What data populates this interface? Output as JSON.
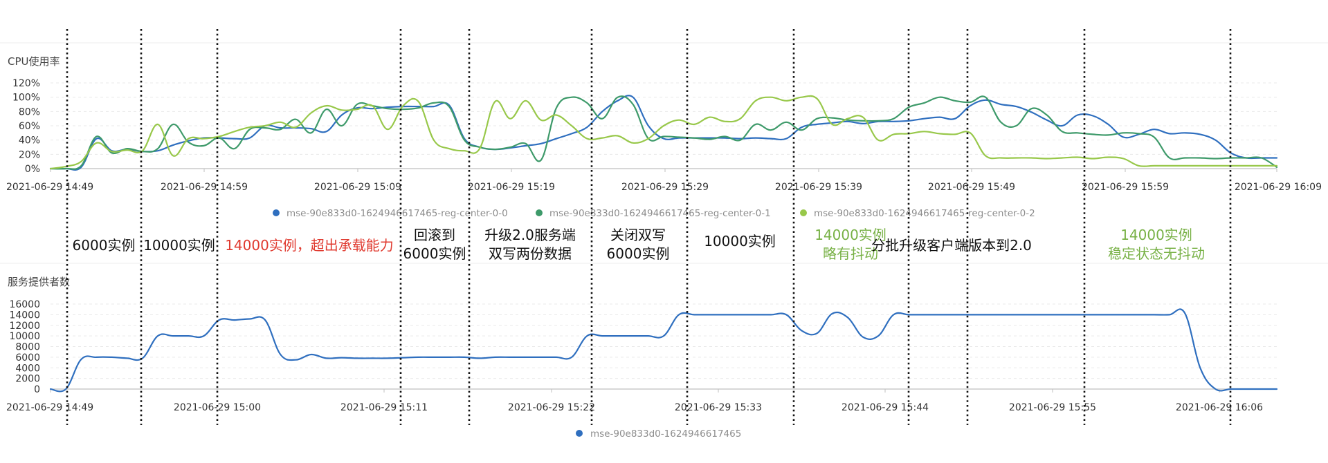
{
  "colors": {
    "series_blue": "#2f6fbf",
    "series_green": "#3e9a6a",
    "series_lightgreen": "#98c84a",
    "annotation_black": "#111111",
    "annotation_red": "#e03a2f",
    "annotation_green": "#78b146",
    "grid": "#e9e9e9",
    "axis": "#bfbfbf",
    "divider": "#111111"
  },
  "chart_data": [
    {
      "type": "line",
      "title": "CPU使用率",
      "y_ticks": [
        "120%",
        "100%",
        "80%",
        "60%",
        "40%",
        "20%",
        "0%"
      ],
      "ylim": [
        0,
        120
      ],
      "x_ticks": [
        "2021-06-29 14:49",
        "2021-06-29 14:59",
        "2021-06-29 15:09",
        "2021-06-29 15:19",
        "2021-06-29 15:29",
        "2021-06-29 15:39",
        "2021-06-29 15:49",
        "2021-06-29 15:59",
        "2021-06-29 16:09"
      ],
      "grid": true,
      "legend_position": "bottom",
      "series": [
        {
          "name": "mse-90e833d0-1624946617465-reg-center-0-0",
          "color_key": "series_blue",
          "x_minutes": [
            0,
            1,
            2,
            3,
            4,
            5,
            6,
            7,
            8,
            9,
            10,
            11,
            12,
            13,
            14,
            15,
            16,
            17,
            18,
            19,
            20,
            21,
            22,
            23,
            24,
            25,
            26,
            27,
            28,
            29,
            30,
            31,
            32,
            33,
            34,
            35,
            36,
            37,
            38,
            39,
            40,
            41,
            42,
            43,
            44,
            45,
            46,
            47,
            48,
            49,
            50,
            51,
            52,
            53,
            54,
            55,
            56,
            57,
            58,
            59,
            60,
            61,
            62,
            63,
            64,
            65,
            66,
            67,
            68,
            69,
            70,
            71,
            72,
            73,
            74,
            75,
            76,
            77,
            78,
            79,
            80
          ],
          "values": [
            0,
            0,
            2,
            42,
            25,
            27,
            24,
            25,
            33,
            39,
            43,
            43,
            42,
            43,
            60,
            57,
            57,
            56,
            52,
            75,
            85,
            84,
            86,
            87,
            87,
            87,
            89,
            42,
            30,
            27,
            29,
            32,
            35,
            42,
            49,
            58,
            80,
            95,
            100,
            60,
            42,
            43,
            43,
            43,
            43,
            42,
            43,
            42,
            42,
            58,
            62,
            64,
            66,
            63,
            66,
            66,
            67,
            70,
            72,
            70,
            88,
            96,
            90,
            87,
            79,
            68,
            60,
            75,
            74,
            62,
            44,
            48,
            55,
            49,
            50,
            48,
            40,
            22,
            15,
            15,
            15
          ]
        },
        {
          "name": "mse-90e833d0-1624946617465-reg-center-0-1",
          "color_key": "series_green",
          "x_minutes": [
            0,
            1,
            2,
            3,
            4,
            5,
            6,
            7,
            8,
            9,
            10,
            11,
            12,
            13,
            14,
            15,
            16,
            17,
            18,
            19,
            20,
            21,
            22,
            23,
            24,
            25,
            26,
            27,
            28,
            29,
            30,
            31,
            32,
            33,
            34,
            35,
            36,
            37,
            38,
            39,
            40,
            41,
            42,
            43,
            44,
            45,
            46,
            47,
            48,
            49,
            50,
            51,
            52,
            53,
            54,
            55,
            56,
            57,
            58,
            59,
            60,
            61,
            62,
            63,
            64,
            65,
            66,
            67,
            68,
            69,
            70,
            71,
            72,
            73,
            74,
            75,
            76,
            77,
            78,
            79,
            80
          ],
          "values": [
            0,
            0,
            4,
            45,
            22,
            28,
            24,
            28,
            62,
            37,
            32,
            43,
            28,
            55,
            57,
            55,
            69,
            50,
            83,
            60,
            90,
            88,
            84,
            83,
            85,
            92,
            87,
            40,
            30,
            27,
            30,
            35,
            12,
            85,
            100,
            92,
            70,
            100,
            90,
            42,
            45,
            44,
            43,
            41,
            45,
            40,
            62,
            54,
            65,
            54,
            70,
            71,
            68,
            67,
            67,
            70,
            86,
            92,
            100,
            95,
            93,
            100,
            65,
            60,
            84,
            75,
            52,
            50,
            48,
            47,
            50,
            49,
            44,
            15,
            15,
            15,
            14,
            15,
            15,
            15,
            2
          ]
        },
        {
          "name": "mse-90e833d0-1624946617465-reg-center-0-2",
          "color_key": "series_lightgreen",
          "x_minutes": [
            0,
            1,
            2,
            3,
            4,
            5,
            6,
            7,
            8,
            9,
            10,
            11,
            12,
            13,
            14,
            15,
            16,
            17,
            18,
            19,
            20,
            21,
            22,
            23,
            24,
            25,
            26,
            27,
            28,
            29,
            30,
            31,
            32,
            33,
            34,
            35,
            36,
            37,
            38,
            39,
            40,
            41,
            42,
            43,
            44,
            45,
            46,
            47,
            48,
            49,
            50,
            51,
            52,
            53,
            54,
            55,
            56,
            57,
            58,
            59,
            60,
            61,
            62,
            63,
            64,
            65,
            66,
            67,
            68,
            69,
            70,
            71,
            72,
            73,
            74,
            75,
            76,
            77,
            78,
            79,
            80
          ],
          "values": [
            0,
            3,
            10,
            36,
            24,
            26,
            25,
            62,
            18,
            42,
            42,
            45,
            52,
            58,
            60,
            65,
            58,
            78,
            88,
            82,
            83,
            88,
            55,
            88,
            94,
            40,
            28,
            25,
            28,
            94,
            70,
            95,
            68,
            75,
            60,
            42,
            43,
            46,
            36,
            42,
            60,
            68,
            62,
            72,
            66,
            70,
            95,
            100,
            95,
            100,
            98,
            62,
            70,
            72,
            40,
            48,
            49,
            52,
            49,
            48,
            50,
            18,
            15,
            15,
            15,
            14,
            15,
            16,
            14,
            16,
            14,
            4,
            4,
            4,
            4,
            4,
            4,
            4,
            4,
            4,
            4
          ]
        }
      ]
    },
    {
      "type": "line",
      "title": "服务提供者数",
      "y_ticks": [
        "16000",
        "14000",
        "12000",
        "10000",
        "8000",
        "6000",
        "4000",
        "2000",
        "0"
      ],
      "ylim": [
        0,
        16000
      ],
      "x_ticks": [
        "2021-06-29 14:49",
        "2021-06-29 15:00",
        "2021-06-29 15:11",
        "2021-06-29 15:22",
        "2021-06-29 15:33",
        "2021-06-29 15:44",
        "2021-06-29 15:55",
        "2021-06-29 16:06"
      ],
      "grid": true,
      "legend_position": "bottom",
      "series": [
        {
          "name": "mse-90e833d0-1624946617465",
          "color_key": "series_blue",
          "x_minutes": [
            0,
            1,
            2,
            3,
            4,
            5,
            6,
            7,
            8,
            9,
            10,
            11,
            12,
            13,
            14,
            15,
            16,
            17,
            18,
            19,
            20,
            21,
            22,
            23,
            24,
            25,
            26,
            27,
            28,
            29,
            30,
            31,
            32,
            33,
            34,
            35,
            36,
            37,
            38,
            39,
            40,
            41,
            42,
            43,
            44,
            45,
            46,
            47,
            48,
            49,
            50,
            51,
            52,
            53,
            54,
            55,
            56,
            57,
            58,
            59,
            60,
            61,
            62,
            63,
            64,
            65,
            66,
            67,
            68,
            69,
            70,
            71,
            72,
            73,
            74,
            75,
            76,
            77,
            78,
            79,
            80
          ],
          "values": [
            0,
            0,
            5600,
            6000,
            6000,
            5800,
            5800,
            10000,
            10000,
            10000,
            10000,
            13000,
            13000,
            13200,
            13000,
            6500,
            5500,
            6500,
            5800,
            5900,
            5800,
            5800,
            5800,
            5900,
            6000,
            6000,
            6000,
            6000,
            5800,
            6000,
            6000,
            6000,
            6000,
            6000,
            6000,
            10000,
            10000,
            10000,
            10000,
            10000,
            10000,
            14000,
            14000,
            14000,
            14000,
            14000,
            14000,
            14000,
            14000,
            11000,
            10500,
            14200,
            13500,
            9800,
            10000,
            14000,
            14000,
            14000,
            14000,
            14000,
            14000,
            14000,
            14000,
            14000,
            14000,
            14000,
            14000,
            14000,
            14000,
            14000,
            14000,
            14000,
            14000,
            14000,
            14300,
            4000,
            0,
            0,
            0,
            0,
            0
          ]
        }
      ]
    }
  ],
  "annotations": [
    {
      "lines": [
        "6000实例"
      ],
      "color_key": "annotation_black"
    },
    {
      "lines": [
        "10000实例"
      ],
      "color_key": "annotation_black"
    },
    {
      "lines": [
        "14000实例，超出承载能力"
      ],
      "color_key": "annotation_red"
    },
    {
      "lines": [
        "回滚到",
        "6000实例"
      ],
      "color_key": "annotation_black"
    },
    {
      "lines": [
        "升级2.0服务端",
        "双写两份数据"
      ],
      "color_key": "annotation_black"
    },
    {
      "lines": [
        "关闭双写",
        "6000实例"
      ],
      "color_key": "annotation_black"
    },
    {
      "lines": [
        "10000实例"
      ],
      "color_key": "annotation_black"
    },
    {
      "lines": [
        "14000实例",
        "略有抖动"
      ],
      "color_key": "annotation_green"
    },
    {
      "lines": [
        "分批升级客户端版本到2.0"
      ],
      "color_key": "annotation_black"
    },
    {
      "lines": [
        "14000实例",
        "稳定状态无抖动"
      ],
      "color_key": "annotation_green"
    }
  ]
}
